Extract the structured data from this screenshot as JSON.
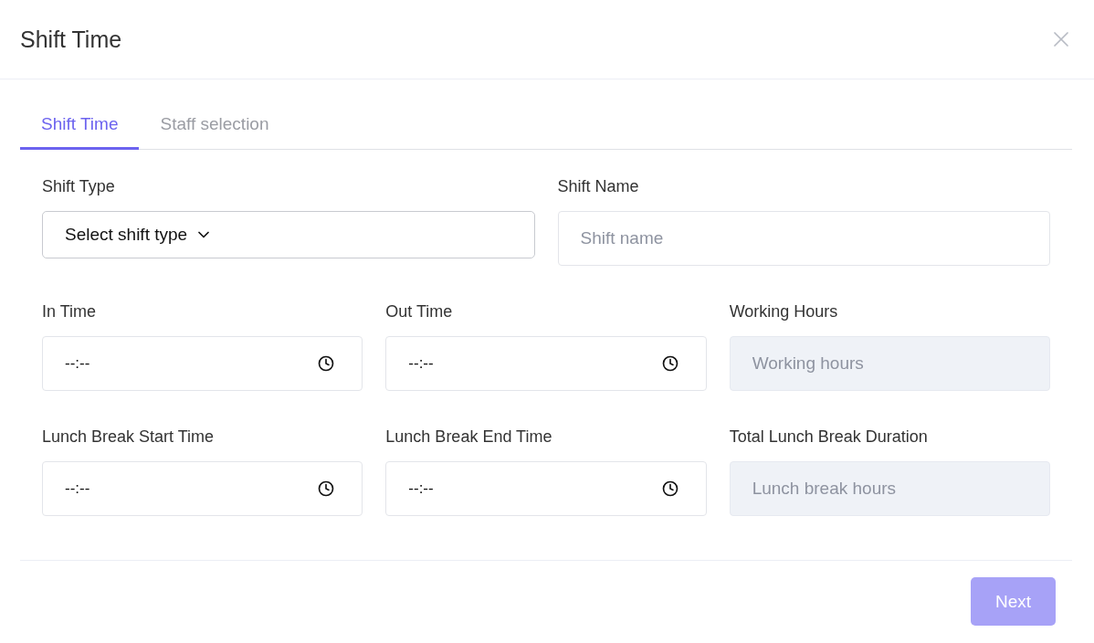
{
  "dialog": {
    "title": "Shift Time"
  },
  "tabs": [
    {
      "label": "Shift Time",
      "selected": true
    },
    {
      "label": "Staff selection",
      "selected": false
    }
  ],
  "rows": [
    [
      {
        "kind": "select",
        "label": "Shift Type",
        "value": "Select shift type"
      },
      {
        "kind": "text",
        "label": "Shift Name",
        "placeholder": "Shift name"
      }
    ],
    [
      {
        "kind": "time",
        "label": "In Time",
        "value": "--:--"
      },
      {
        "kind": "time",
        "label": "Out Time",
        "value": "--:--"
      },
      {
        "kind": "readonly",
        "label": "Working Hours",
        "placeholder": "Working hours"
      }
    ],
    [
      {
        "kind": "time",
        "label": "Lunch Break Start Time",
        "value": "--:--"
      },
      {
        "kind": "time",
        "label": "Lunch Break End Time",
        "value": "--:--"
      },
      {
        "kind": "readonly",
        "label": "Total Lunch Break Duration",
        "placeholder": "Lunch break hours"
      }
    ]
  ],
  "next_button": {
    "label": "Next",
    "disabled": true
  }
}
